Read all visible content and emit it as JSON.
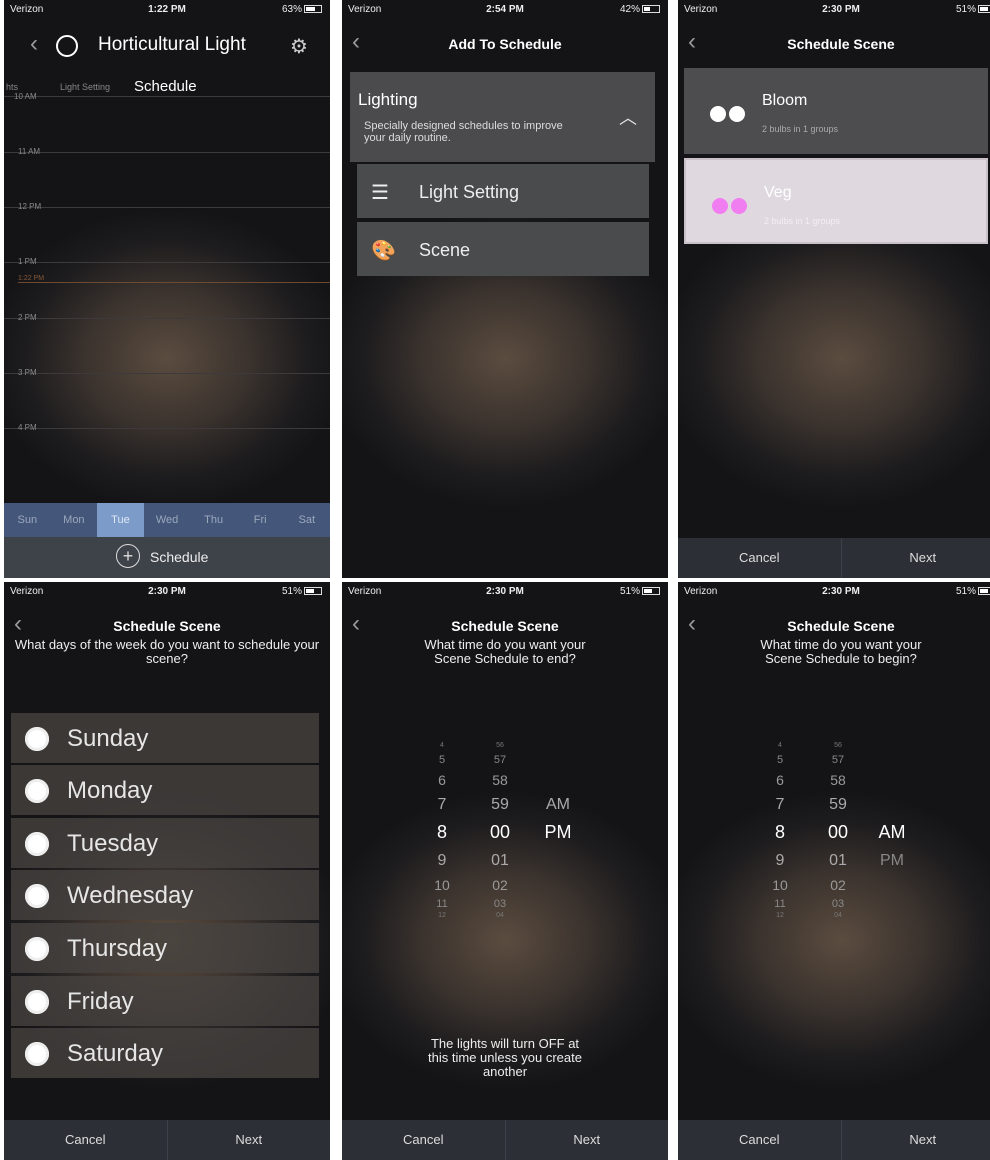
{
  "status_bars": [
    {
      "carrier": "Verizon",
      "time": "1:22 PM",
      "battery": "63%",
      "level": 0.63
    },
    {
      "carrier": "Verizon",
      "time": "2:54 PM",
      "battery": "42%",
      "level": 0.42
    },
    {
      "carrier": "Verizon",
      "time": "2:30 PM",
      "battery": "51%",
      "level": 0.51
    },
    {
      "carrier": "Verizon",
      "time": "2:30 PM",
      "battery": "51%",
      "level": 0.51
    },
    {
      "carrier": "Verizon",
      "time": "2:30 PM",
      "battery": "51%",
      "level": 0.51
    },
    {
      "carrier": "Verizon",
      "time": "2:30 PM",
      "battery": "51%",
      "level": 0.51
    }
  ],
  "panel1": {
    "title": "Horticultural Light",
    "subtabs": [
      "hts",
      "Light Setting",
      "Schedule"
    ],
    "hours": [
      "10 AM",
      "11 AM",
      "12 PM",
      "1 PM",
      "2 PM",
      "3 PM",
      "4 PM"
    ],
    "now_label": "1:22 PM",
    "days": [
      "Sun",
      "Mon",
      "Tue",
      "Wed",
      "Thu",
      "Fri",
      "Sat"
    ],
    "selected_day": "Tue",
    "add_label": "Schedule"
  },
  "panel2": {
    "title": "Add To Schedule",
    "section_title": "Lighting",
    "section_desc": "Specially designed schedules to improve your daily routine.",
    "options": [
      "Light Setting",
      "Scene"
    ]
  },
  "panel3": {
    "title": "Schedule Scene",
    "scenes": [
      {
        "name": "Bloom",
        "sub": "2 bulbs in 1 groups",
        "dot_color": "#ffffff",
        "selected": false
      },
      {
        "name": "Veg",
        "sub": "2 bulbs in 1 groups",
        "dot_color": "#f07ef0",
        "selected": true
      }
    ]
  },
  "panel4": {
    "title": "Schedule Scene",
    "question": "What days of the week do you want to schedule your scene?",
    "days": [
      "Sunday",
      "Monday",
      "Tuesday",
      "Wednesday",
      "Thursday",
      "Friday",
      "Saturday"
    ]
  },
  "panel5": {
    "title": "Schedule Scene",
    "question": "What time do you want your Scene Schedule to end?",
    "hours": [
      "4",
      "5",
      "6",
      "7",
      "8",
      "9",
      "10",
      "11",
      "12"
    ],
    "minutes": [
      "56",
      "57",
      "58",
      "59",
      "00",
      "01",
      "02",
      "03",
      "04"
    ],
    "ampm": [
      "AM",
      "PM"
    ],
    "selected": {
      "hour": "8",
      "minute": "00",
      "period": "PM"
    },
    "footer": "The lights will turn OFF at this time unless you create another"
  },
  "panel6": {
    "title": "Schedule Scene",
    "question": "What time do you want your Scene Schedule to begin?",
    "hours": [
      "4",
      "5",
      "6",
      "7",
      "8",
      "9",
      "10",
      "11",
      "12"
    ],
    "minutes": [
      "56",
      "57",
      "58",
      "59",
      "00",
      "01",
      "02",
      "03",
      "04"
    ],
    "ampm": [
      "AM",
      "PM"
    ],
    "selected": {
      "hour": "8",
      "minute": "00",
      "period": "AM"
    }
  },
  "buttons": {
    "cancel": "Cancel",
    "next": "Next"
  }
}
